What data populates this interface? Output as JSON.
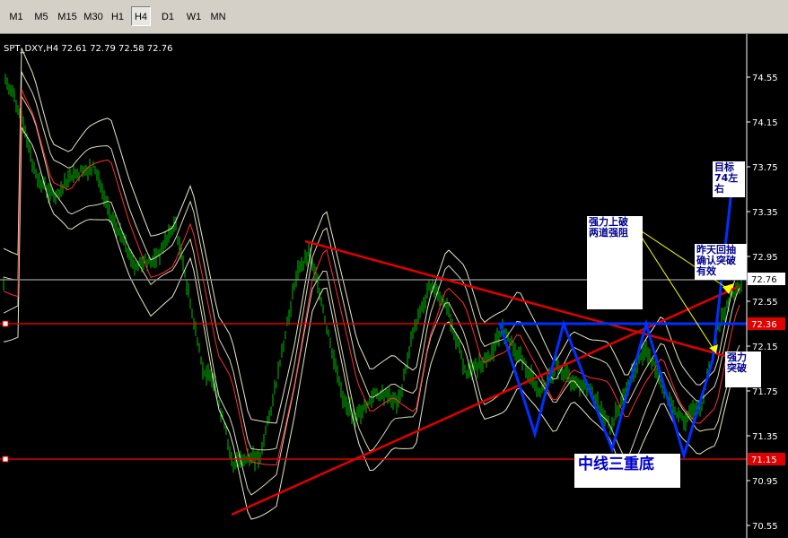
{
  "toolbar": {
    "timeframes": [
      {
        "label": "M1",
        "active": false
      },
      {
        "label": "M5",
        "active": false
      },
      {
        "label": "M15",
        "active": false
      },
      {
        "label": "M30",
        "active": false
      },
      {
        "label": "H1",
        "active": false
      },
      {
        "label": "H4",
        "active": true
      },
      {
        "label": "D1",
        "active": false
      },
      {
        "label": "W1",
        "active": false
      },
      {
        "label": "MN",
        "active": false
      }
    ]
  },
  "chart": {
    "symbol_info": "SPT_DXY,H4  72.61 72.79 72.58 72.76",
    "price_axis": [
      "74.55",
      "74.15",
      "73.75",
      "73.35",
      "72.95",
      "72.55",
      "72.15",
      "71.75",
      "71.35",
      "70.95",
      "70.55"
    ],
    "current_price": "72.76",
    "level_labels": {
      "resistance": "72.36",
      "support": "71.15"
    },
    "colors": {
      "background": "#000000",
      "candle": "#00c000",
      "bands": "#e8e8c8",
      "trend_red": "#e00000",
      "pattern_blue": "#0030ff",
      "note_arrow": "#ffff00"
    }
  },
  "annotations": {
    "breakout_above_channel": [
      "强力上破",
      "两道强阻"
    ],
    "target": [
      "目标",
      "74左",
      "右"
    ],
    "retest_confirmed": [
      "昨天回抽",
      "确认突破",
      "有效"
    ],
    "strong_breakout": [
      "强力",
      "突破"
    ],
    "triple_bottom": "中线三重底"
  }
}
